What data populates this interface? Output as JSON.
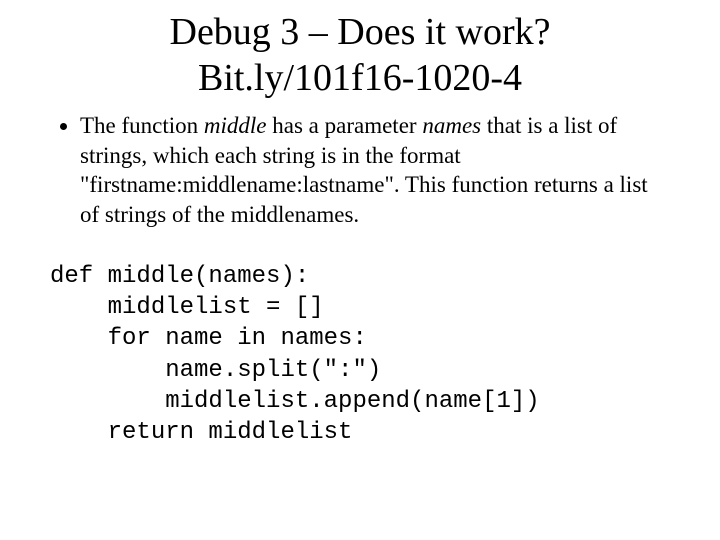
{
  "title": {
    "line1": "Debug 3 – Does it work?",
    "line2": "Bit.ly/101f16-1020-4"
  },
  "bullet": {
    "seg1": "The function ",
    "seg2_italic": "middle",
    "seg3": " has a parameter ",
    "seg4_italic": "names",
    "seg5": " that is a list of strings, which each string is in the format \"firstname:middlename:lastname\". This function returns a list of strings of the middlenames."
  },
  "code": {
    "l1": "def middle(names):",
    "l2": "    middlelist = []",
    "l3": "    for name in names:",
    "l4": "        name.split(\":\")",
    "l5": "        middlelist.append(name[1])",
    "l6": "    return middlelist"
  }
}
